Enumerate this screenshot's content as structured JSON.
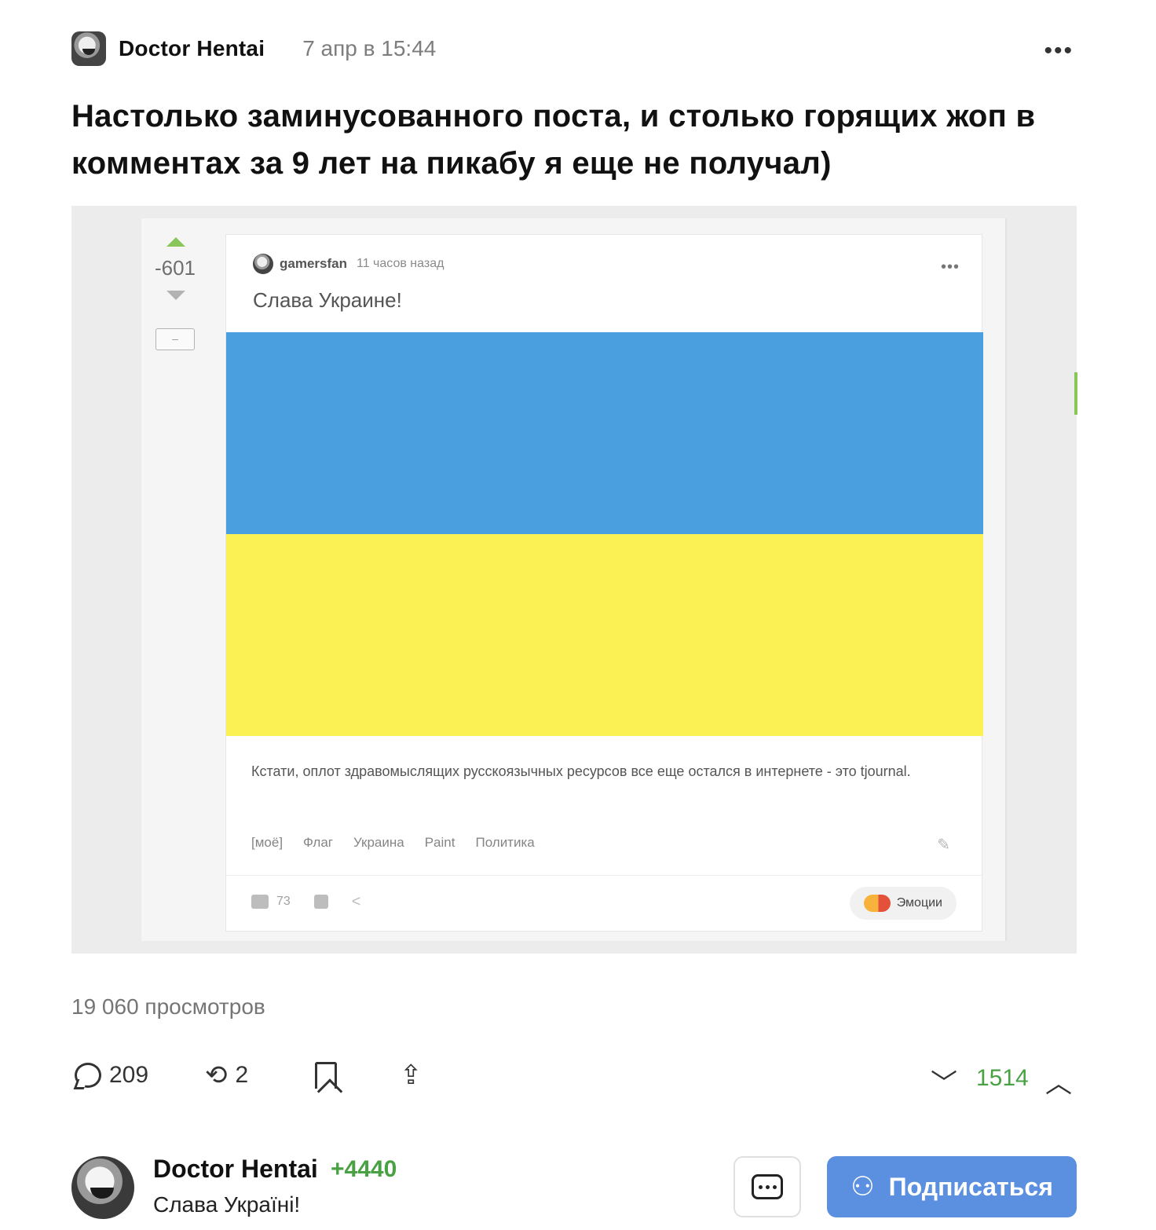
{
  "post": {
    "author": "Doctor Hentai",
    "date": "7 апр в 15:44",
    "title": "Настолько заминусованного поста, и столько горящих жоп в комментах за 9 лет на пикабу я еще не получал)",
    "views": "19 060 просмотров"
  },
  "screenshot": {
    "score": "-601",
    "minus_label": "–",
    "user": "gamersfan",
    "time": "11 часов назад",
    "title": "Слава Украине!",
    "text": "Кстати, оплот здравомыслящих русскоязычных ресурсов все еще остался в интернете - это tjournal.",
    "tags": [
      "[моё]",
      "Флаг",
      "Украина",
      "Paint",
      "Политика"
    ],
    "comments": "73",
    "emotions_label": "Эмоции",
    "colors": {
      "flag_blue": "#4aa0de",
      "flag_yellow": "#fbf154"
    }
  },
  "actions": {
    "comments": "209",
    "reposts": "2",
    "rating": "1514"
  },
  "author_bar": {
    "name": "Doctor Hentai",
    "karma": "+4440",
    "status": "Слава Україні!",
    "subscribe_label": "Подписаться"
  },
  "icons": {
    "more": "more-icon",
    "comment": "comment-icon",
    "repost": "repost-icon",
    "bookmark": "bookmark-icon",
    "share": "share-icon",
    "vote_down": "chevron-down-icon",
    "vote_up": "chevron-up-icon",
    "message": "message-icon",
    "subscribe": "add-user-icon"
  },
  "colors": {
    "accent": "#5b8fe0",
    "positive": "#4aa143"
  }
}
